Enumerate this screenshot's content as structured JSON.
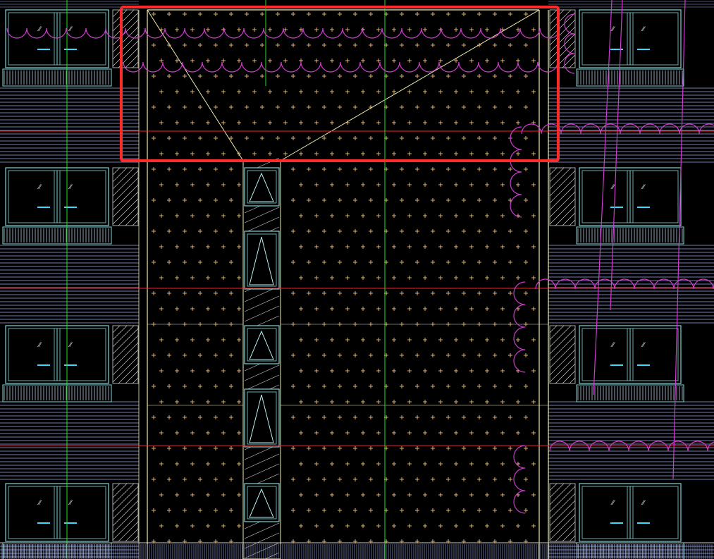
{
  "drawing": {
    "background": "#000000",
    "colors": {
      "hatch_cross": "#f2c07a",
      "wall_line": "#f0ecb0",
      "window_frame": "#7fd6d6",
      "axis_green": "#22dd22",
      "level_red": "#ff2020",
      "revision_cloud": "#d23ad2",
      "siding": "#9aa6e6",
      "highlight_box": "#ff2a2a",
      "door_marker": "#3fd9ff",
      "triangle_glass": "#b8f0f0",
      "white_lines": "#e8e8e8"
    },
    "elements": {
      "facade_left": "left balcony stack (4 floors)",
      "facade_right": "right balcony stack (4 floors)",
      "central_wall": "dotted cross-hatch wall panel",
      "stair_windows": "vertical strip of 5 triangular windows",
      "highlight": "red rectangle selection at top of central panel",
      "clouds": "magenta revision clouds"
    }
  }
}
